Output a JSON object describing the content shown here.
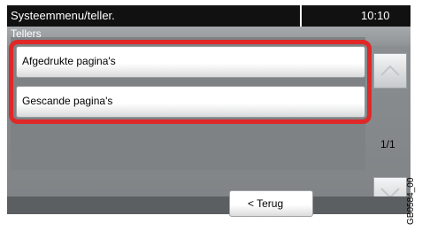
{
  "header": {
    "title": "Systeemmenu/teller.",
    "time": "10:10"
  },
  "tab": {
    "label": "Tellers"
  },
  "list": {
    "items": [
      {
        "label": "Afgedrukte pagina's"
      },
      {
        "label": "Gescande pagina's"
      }
    ]
  },
  "pager": {
    "indicator": "1/1"
  },
  "footer": {
    "back_label": "< Terug"
  },
  "figure_code": "GB0584_00",
  "colors": {
    "highlight": "#e02828",
    "title_bar": "#111111"
  },
  "icons": {
    "scroll_up": "chevron-up-icon",
    "scroll_down": "chevron-down-icon"
  }
}
